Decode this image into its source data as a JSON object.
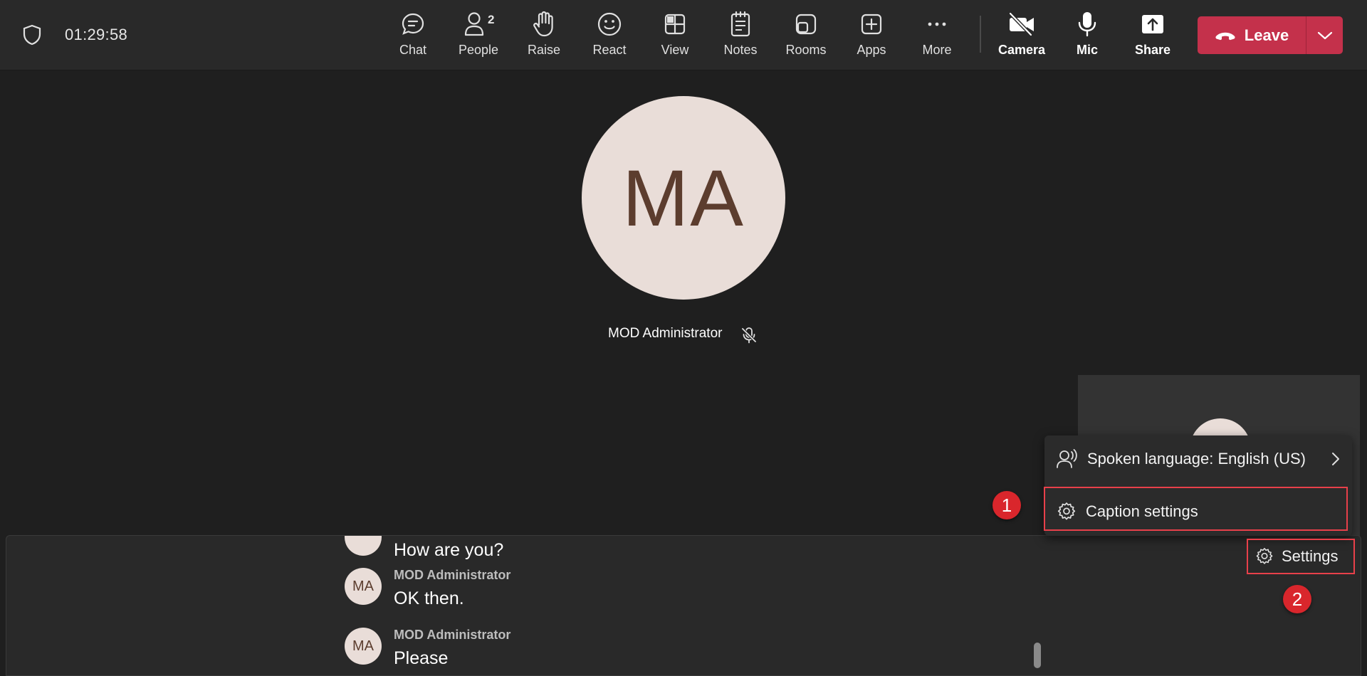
{
  "meeting": {
    "timer": "01:29:58"
  },
  "toolbar": {
    "chat": "Chat",
    "people": "People",
    "people_count": "2",
    "raise": "Raise",
    "react": "React",
    "view": "View",
    "notes": "Notes",
    "rooms": "Rooms",
    "apps": "Apps",
    "more": "More",
    "camera": "Camera",
    "mic": "Mic",
    "share": "Share",
    "leave": "Leave"
  },
  "stage": {
    "initials": "MA",
    "participant_name": "MOD Administrator"
  },
  "captions": [
    {
      "text": "How are you?"
    },
    {
      "initials": "MA",
      "name": "MOD Administrator",
      "text": "OK then."
    },
    {
      "initials": "MA",
      "name": "MOD Administrator",
      "text": "Please"
    }
  ],
  "caption_menu": {
    "spoken_language": "Spoken language: English (US)",
    "caption_settings": "Caption settings"
  },
  "settings_button": "Settings",
  "annotations": {
    "step1": "1",
    "step2": "2"
  },
  "colors": {
    "leave": "#c4314b",
    "highlight": "#e8404a",
    "avatar_bg": "#e9ddd8",
    "avatar_text": "#5c3d2e"
  }
}
